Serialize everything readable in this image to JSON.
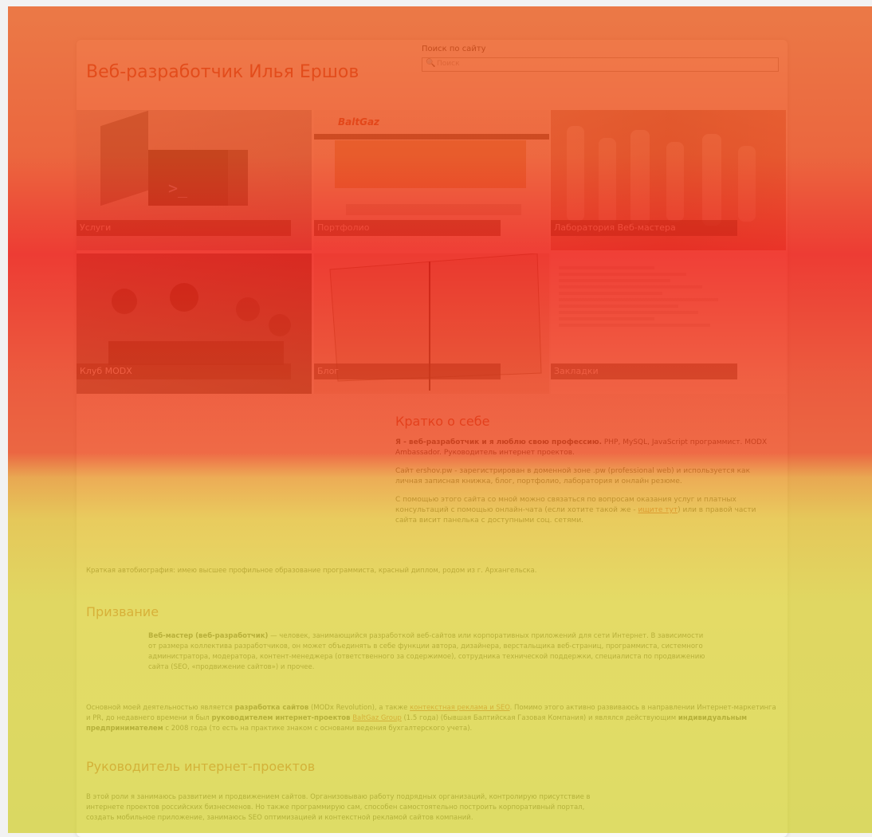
{
  "site": {
    "title": "Веб-разработчик Илья Ершов"
  },
  "search": {
    "label": "Поиск по сайту",
    "placeholder": "Поиск"
  },
  "tiles": [
    {
      "label": "Услуги"
    },
    {
      "label": "Портфолио",
      "logo": "BaltGaz"
    },
    {
      "label": "Лаборатория Веб-мастера"
    },
    {
      "label": "Клуб MODX"
    },
    {
      "label": "Блог"
    },
    {
      "label": "Закладки"
    }
  ],
  "about": {
    "title": "Кратко о себе",
    "p1_bold": "Я - веб-разработчик и я люблю свою профессию.",
    "p1_rest": " PHP, MySQL, JavaScript программист. MODX Ambassador. Руководитель интернет проектов.",
    "p2": "Сайт ershov.pw - зарегистрирован в доменной зоне .pw (professional web) и используется как личная записная книжка, блог, портфолио, лаборатория и онлайн резюме.",
    "p3_start": "С помощью этого сайта со мной можно связаться по вопросам оказания услуг и платных консультаций с помощью онлайн-чата (если хотите такой же - ",
    "p3_link": "ищите тут",
    "p3_end": ") или в правой части сайта висит панелька с доступными соц. сетями.",
    "p4": "Краткая автобиография: имею высшее профильное образование программиста, красный диплом, родом из г. Архангельска."
  },
  "calling": {
    "title": "Призвание",
    "def_bold": "Веб-мастер (веб-разработчик)",
    "def_text": " — человек, занимающийся разработкой веб-сайтов или корпоративных приложений для сети Интернет. В зависимости от размера коллектива разработчиков, он может объединять в себе функции автора, дизайнера, верстальщика веб-страниц, программиста, системного администратора, модератора, контент-менеджера (ответственного за содержимое), сотрудника технической поддержки, специалиста по продвижению сайта (SEO, «продвижение сайтов») и прочее.",
    "main_1": "Основной моей деятельностью является ",
    "main_b1": "разработка сайтов",
    "main_2": " (MODx Revolution), а также ",
    "main_l1": "контекстная реклама и SEO",
    "main_3": ". Помимо этого активно развиваюсь в направлении Интернет-маркетинга и PR, до недавнего времени я был ",
    "main_b2": "руководителем интернет-проектов",
    "main_4": " ",
    "main_l2": "BaltGaz Group",
    "main_5": " (1.5 года) (бывшая Балтийская Газовая Компания) и являлся действующим ",
    "main_b3": "индивидуальным предпринимателем",
    "main_6": " с 2008 года (то есть на практике знаком с основами ведения бухгалтерского учета)."
  },
  "manager": {
    "title": "Руководитель интернет-проектов",
    "p1": "В этой роли я занимаюсь развитием и продвижением сайтов. Организовываю работу подрядных организаций, контролирую присутствие в интернете проектов российских бизнесменов. Но также программирую сам, способен самостоятельно построить корпоративный портал, создать мобильное приложение, занимаюсь SEO оптимизацией и контекстной рекламой сайтов компаний."
  },
  "colors": {
    "accent": "#c0392b",
    "heat_top": "#ec5a19",
    "heat_mid": "#ee1e14",
    "heat_bottom": "#d6d43c"
  }
}
